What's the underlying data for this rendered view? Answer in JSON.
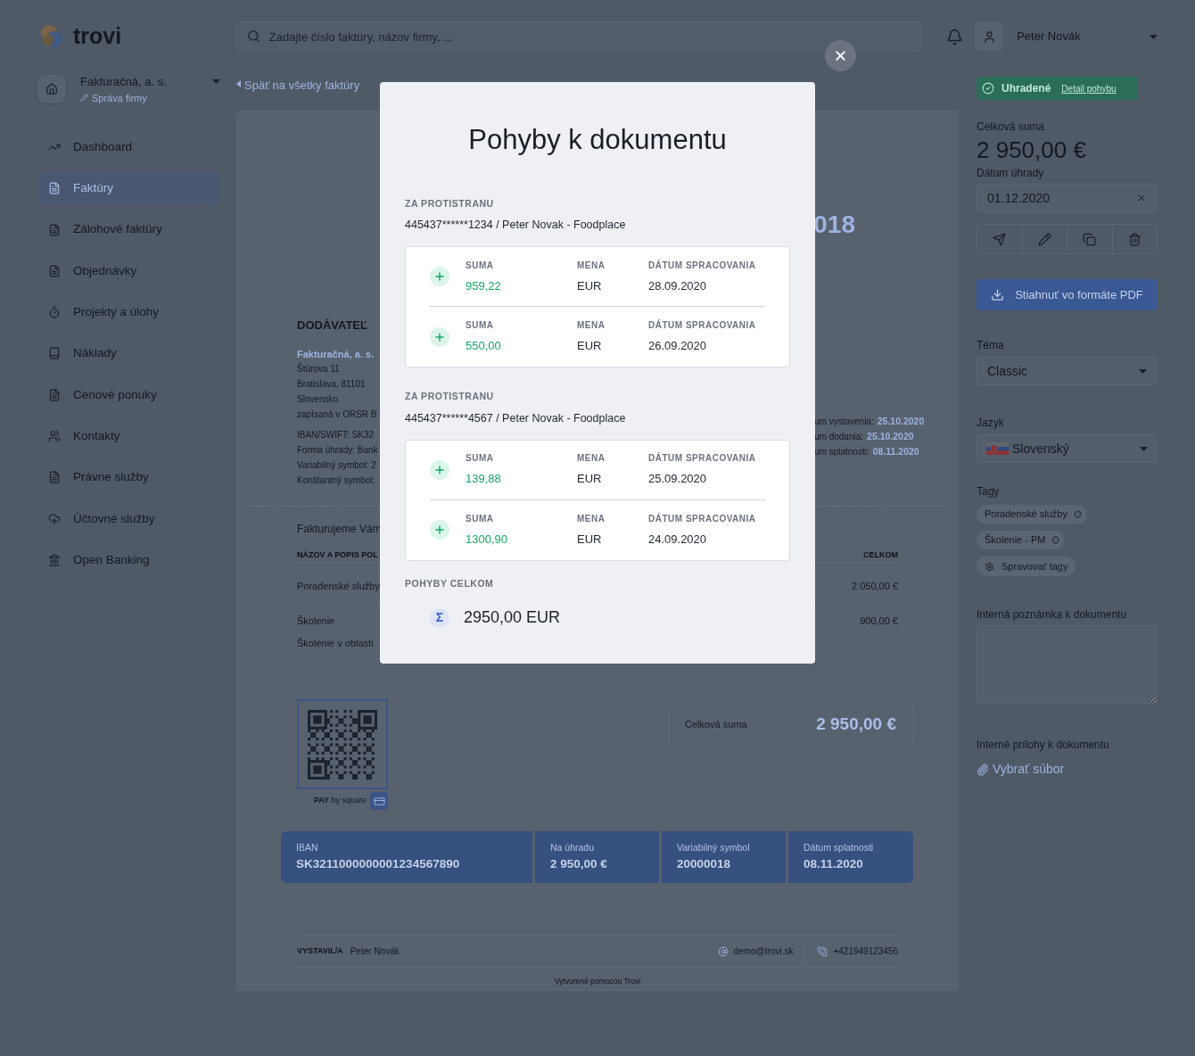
{
  "header": {
    "logo": "trovi",
    "search": {
      "placeholder": "Zadajte číslo faktúry, názov firmy, ..."
    },
    "user": "Peter Novák"
  },
  "company": {
    "name": "Fakturačná, a. s.",
    "manage": "Správa firmy"
  },
  "nav": [
    {
      "label": "Dashboard",
      "selected": false
    },
    {
      "label": "Faktúry",
      "selected": true
    },
    {
      "label": "Zálohové faktúry",
      "selected": false
    },
    {
      "label": "Objednávky",
      "selected": false
    },
    {
      "label": "Projekty a úlohy",
      "selected": false
    },
    {
      "label": "Náklady",
      "selected": false
    },
    {
      "label": "Cenové ponuky",
      "selected": false
    },
    {
      "label": "Kontakty",
      "selected": false
    },
    {
      "label": "Právne služby",
      "selected": false
    },
    {
      "label": "Účtovné služby",
      "selected": false
    },
    {
      "label": "Open Banking",
      "selected": false
    }
  ],
  "back_link": "Späť na všetky faktúry",
  "invoice": {
    "number": "018",
    "supplier_heading": "DODÁVATEĽ",
    "supplier_name": "Fakturačná, a. s.",
    "address": [
      "Štúrova 11",
      "Bratislava, 81101",
      "Slovensko",
      "zapísaná v ORSR B"
    ],
    "payment_info": [
      "IBAN/SWIFT: SK32",
      "Forma úhrady: Bank",
      "Variabilný symbol: 2",
      "Konštantný symbol:"
    ],
    "dates": [
      {
        "label": "um vystavenia:",
        "value": "25.10.2020"
      },
      {
        "label": "um dodania:",
        "value": "25.10.2020"
      },
      {
        "label": "um splatnosti:",
        "value": "08.11.2020"
      }
    ],
    "intro": "Fakturujeme Vám",
    "columns": [
      "NÁZOV A POPIS POL",
      "CELKOM"
    ],
    "rows": [
      {
        "name": "Poradenské služby",
        "total": "2 050,00 €"
      },
      {
        "name": "Školenie",
        "description": "Školenie v oblasti",
        "total": "900,00 €"
      }
    ],
    "qr_caption": "**PAY** by square",
    "total_label": "Celková suma",
    "total_value": "2 950,00 €",
    "payment_bar": [
      {
        "label": "IBAN",
        "value": "SK3211000000001234567890"
      },
      {
        "label": "Na úhradu",
        "value": "2 950,00 €"
      },
      {
        "label": "Variabilný symbol",
        "value": "20000018"
      },
      {
        "label": "Dátum splatnosti",
        "value": "08.11.2020"
      }
    ],
    "issued_label": "VYSTAVIL/A",
    "issued_by": "Peter Novák",
    "email": "demo@trovi.sk",
    "phone": "+421949123456",
    "credit": "Vytvorené pomocou Trovi"
  },
  "side_panel": {
    "status": "Uhradené",
    "status_link": "Detail pohybu",
    "total_label": "Celková suma",
    "total_value": "2 950,00 €",
    "paid_date_label": "Dátum úhrady",
    "paid_date": "01.12.2020",
    "download": "Stiahnuť vo formáte PDF",
    "theme_label": "Téma",
    "theme": "Classic",
    "language_label": "Jazyk",
    "language": "Slovenský",
    "tags_label": "Tagy",
    "tags": [
      "Poradenské služby",
      "Školenie - PM"
    ],
    "manage_tags": "Spravovať tagy",
    "note_label": "Interná poznámka k dokumentu",
    "attachments_label": "Interné prílohy k dokumentu",
    "choose_file": "Vybrať súbor"
  },
  "modal": {
    "title": "Pohyby k dokumentu",
    "groups": [
      {
        "heading": "ZA PROTISTRANU",
        "account": "445437******1234 / Peter Novak - Foodplace",
        "movements": [
          {
            "amount_label": "SUMA",
            "amount": "959,22",
            "currency_label": "MENA",
            "currency": "EUR",
            "date_label": "DÁTUM SPRACOVANIA",
            "date": "28.09.2020"
          },
          {
            "amount_label": "SUMA",
            "amount": "550,00",
            "currency_label": "MENA",
            "currency": "EUR",
            "date_label": "DÁTUM SPRACOVANIA",
            "date": "26.09.2020"
          }
        ]
      },
      {
        "heading": "ZA PROTISTRANU",
        "account": "445437******4567 / Peter Novak - Foodplace",
        "movements": [
          {
            "amount_label": "SUMA",
            "amount": "139,88",
            "currency_label": "MENA",
            "currency": "EUR",
            "date_label": "DÁTUM SPRACOVANIA",
            "date": "25.09.2020"
          },
          {
            "amount_label": "SUMA",
            "amount": "1300,90",
            "currency_label": "MENA",
            "currency": "EUR",
            "date_label": "DÁTUM SPRACOVANIA",
            "date": "24.09.2020"
          }
        ]
      }
    ],
    "total_heading": "POHYBY CELKOM",
    "total_symbol": "Σ",
    "total": "2950,00 EUR"
  }
}
